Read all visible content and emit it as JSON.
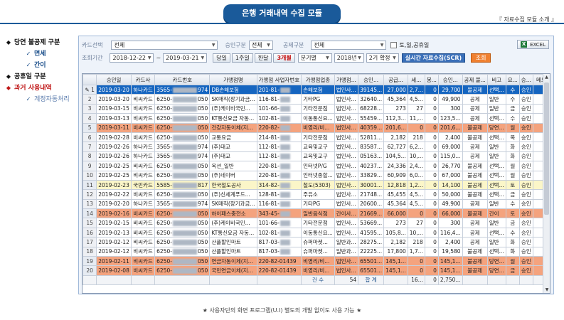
{
  "header": {
    "title": "은행 거래내역 수집 모듈",
    "caption": "『 자료수집 모듈 소개 』"
  },
  "nav": [
    {
      "label": "당연 불공제 구분",
      "level": 1
    },
    {
      "label": "면세",
      "level": 2
    },
    {
      "label": "간이",
      "level": 2
    },
    {
      "label": "공휴일 구분",
      "level": 1
    },
    {
      "label": "과거 사용내역",
      "level": 1,
      "active": true
    },
    {
      "label": "계정자동처리",
      "level": 2,
      "sub": true
    }
  ],
  "filters": {
    "card_label": "카드선택",
    "card_value": "전체",
    "approval_label": "승인구분",
    "approval_value": "전체",
    "deduct_label": "공제구분",
    "deduct_value": "전체",
    "holiday_label": "토,일,공휴일",
    "excel_label": "EXCEL",
    "period_label": "조회기간",
    "date_from": "2018-12-22",
    "tilde": "~",
    "date_to": "2019-03-21",
    "btn_day": "당일",
    "btn_week": "1주일",
    "btn_half_month": "한달",
    "btn_3month": "3개월",
    "quarter_value": "분기별",
    "year_value": "2018년",
    "term_value": "2기 확정",
    "realtime_btn": "실시간 자료수집(SCR)",
    "search_btn": "조회"
  },
  "columns": [
    "",
    "승인일",
    "카드사",
    "카드번호",
    "가맹점명",
    "가맹점 사업자번호",
    "가맹점업종",
    "가맹점...",
    "승인...",
    "공급...",
    "세...",
    "봉...",
    "승인...",
    "공제 불...",
    "비고",
    "요...",
    "승...",
    "메모"
  ],
  "rows": [
    {
      "n": "1",
      "d": "2019-03-20",
      "co": "하나카드",
      "p1": "3565-",
      "p2": "974",
      "m": "DB손해보험",
      "b1": "201-81-",
      "b2": "",
      "t": "손해보험",
      "ty": "법인사...",
      "a": "39145...",
      "s": "27,000",
      "v": "2,7...",
      "f": "0",
      "tot": "29,700",
      "ded": "불공제",
      "note": "선택...",
      "dy": "수",
      "st": "승인",
      "style": "sel"
    },
    {
      "n": "2",
      "d": "2019-03-20",
      "co": "비씨카드",
      "p1": "6250-",
      "p2": "050",
      "m": "SK매직(장기과금...",
      "b1": "116-81-",
      "b2": "",
      "t": "기타PG",
      "ty": "법인사...",
      "a": "32640...",
      "s": "45,364",
      "v": "4,5...",
      "f": "0",
      "tot": "49,900",
      "ded": "공제",
      "note": "일반",
      "dy": "수",
      "st": "승인",
      "style": ""
    },
    {
      "n": "3",
      "d": "2019-03-15",
      "co": "비씨카드",
      "p1": "6250-",
      "p2": "050",
      "m": "(주)케이비국민...",
      "b1": "101-66-",
      "b2": "",
      "t": "기타전문점",
      "ty": "법인사...",
      "a": "68228...",
      "s": "273",
      "v": "27",
      "f": "0",
      "tot": "300",
      "ded": "공제",
      "note": "일반",
      "dy": "금",
      "st": "승인",
      "style": ""
    },
    {
      "n": "4",
      "d": "2019-03-13",
      "co": "비씨카드",
      "p1": "6250-",
      "p2": "050",
      "m": "KT통신요금 자동...",
      "b1": "102-81-",
      "b2": "",
      "t": "이동통신요...",
      "ty": "법인사...",
      "a": "55459...",
      "s": "112,3...",
      "v": "11,...",
      "f": "0",
      "tot": "123,5...",
      "ded": "공제",
      "note": "선택...",
      "dy": "수",
      "st": "승인",
      "style": ""
    },
    {
      "n": "5",
      "d": "2019-03-11",
      "co": "비씨카드",
      "p1": "6250-",
      "p2": "050",
      "m": "건강자동이체(지...",
      "b1": "220-82-",
      "b2": "",
      "t": "비영리/비...",
      "ty": "법인사...",
      "a": "40359...",
      "s": "201,6...",
      "v": "0",
      "f": "0",
      "tot": "201,6...",
      "ded": "불공제",
      "note": "당연...",
      "dy": "월",
      "st": "승인",
      "style": "orange"
    },
    {
      "n": "6",
      "d": "2019-02-28",
      "co": "비씨카드",
      "p1": "6250-",
      "p2": "050",
      "m": "교통요금",
      "b1": "214-81-",
      "b2": "",
      "t": "기타전문점",
      "ty": "법인사...",
      "a": "52811...",
      "s": "2,182",
      "v": "218",
      "f": "0",
      "tot": "2,400",
      "ded": "불공제",
      "note": "선택...",
      "dy": "목",
      "st": "승인",
      "style": ""
    },
    {
      "n": "7",
      "d": "2019-02-26",
      "co": "하나카드",
      "p1": "3565-",
      "p2": "974",
      "m": "(주)대교",
      "b1": "112-81-",
      "b2": "",
      "t": "교육및교구",
      "ty": "법인사...",
      "a": "83587...",
      "s": "62,727",
      "v": "6,2...",
      "f": "0",
      "tot": "69,000",
      "ded": "공제",
      "note": "일반",
      "dy": "화",
      "st": "승인",
      "style": ""
    },
    {
      "n": "8",
      "d": "2019-02-26",
      "co": "하나카드",
      "p1": "3565-",
      "p2": "974",
      "m": "(주)대교",
      "b1": "112-81-",
      "b2": "",
      "t": "교육및교구",
      "ty": "법인사...",
      "a": "05163...",
      "s": "104,5...",
      "v": "10,...",
      "f": "0",
      "tot": "115,0...",
      "ded": "공제",
      "note": "일반",
      "dy": "화",
      "st": "승인",
      "style": ""
    },
    {
      "n": "9",
      "d": "2019-02-25",
      "co": "비씨카드",
      "p1": "6250-",
      "p2": "050",
      "m": "옥션_일반",
      "b1": "220-81-",
      "b2": "",
      "t": "인터넷P/G",
      "ty": "법인사...",
      "a": "40237...",
      "s": "24,336",
      "v": "2,4...",
      "f": "0",
      "tot": "26,770",
      "ded": "불공제",
      "note": "선택...",
      "dy": "월",
      "st": "승인",
      "style": ""
    },
    {
      "n": "10",
      "d": "2019-02-25",
      "co": "비씨카드",
      "p1": "6250-",
      "p2": "050",
      "m": "(주)네이버",
      "b1": "220-81-",
      "b2": "",
      "t": "인터넷종합...",
      "ty": "법인사...",
      "a": "33829...",
      "s": "60,909",
      "v": "6,0...",
      "f": "0",
      "tot": "67,000",
      "ded": "불공제",
      "note": "선택...",
      "dy": "월",
      "st": "승인",
      "style": ""
    },
    {
      "n": "11",
      "d": "2019-02-23",
      "co": "국민카드",
      "p1": "5585-",
      "p2": "817",
      "m": "한국철도공사",
      "b1": "314-82-",
      "b2": "",
      "t": "철도(5303)",
      "ty": "법인사...",
      "a": "30001...",
      "s": "12,818",
      "v": "1,2...",
      "f": "0",
      "tot": "14,100",
      "ded": "불공제",
      "note": "선택...",
      "dy": "토",
      "st": "승인",
      "style": "yellow"
    },
    {
      "n": "12",
      "d": "2019-02-22",
      "co": "비씨카드",
      "p1": "6250-",
      "p2": "050",
      "m": "(주)신세계푸드...",
      "b1": "128-81-",
      "b2": "",
      "t": "주유소",
      "ty": "법인사...",
      "a": "21748...",
      "s": "45,455",
      "v": "4,5...",
      "f": "0",
      "tot": "50,000",
      "ded": "불공제",
      "note": "선택...",
      "dy": "금",
      "st": "승인",
      "style": ""
    },
    {
      "n": "13",
      "d": "2019-02-20",
      "co": "하나카드",
      "p1": "3565-",
      "p2": "974",
      "m": "SK매직(장기과금...",
      "b1": "116-81-",
      "b2": "",
      "t": "기타PG",
      "ty": "법인사...",
      "a": "20600...",
      "s": "45,364",
      "v": "4,5...",
      "f": "0",
      "tot": "49,900",
      "ded": "공제",
      "note": "일반",
      "dy": "수",
      "st": "승인",
      "style": ""
    },
    {
      "n": "14",
      "d": "2019-02-16",
      "co": "비씨카드",
      "p1": "6250-",
      "p2": "050",
      "m": "하이패스충전소",
      "b1": "343-45-",
      "b2": "",
      "t": "일반음식점",
      "ty": "간이사...",
      "a": "21669...",
      "s": "66,000",
      "v": "0",
      "f": "0",
      "tot": "66,000",
      "ded": "불공제",
      "note": "간이",
      "dy": "토",
      "st": "승인",
      "style": "orange"
    },
    {
      "n": "15",
      "d": "2019-02-15",
      "co": "비씨카드",
      "p1": "6250-",
      "p2": "050",
      "m": "(주)케이비국민...",
      "b1": "101-66-",
      "b2": "",
      "t": "기타전문점",
      "ty": "법인사...",
      "a": "53669...",
      "s": "273",
      "v": "27",
      "f": "0",
      "tot": "300",
      "ded": "공제",
      "note": "일반",
      "dy": "금",
      "st": "승인",
      "style": ""
    },
    {
      "n": "16",
      "d": "2019-02-13",
      "co": "비씨카드",
      "p1": "6250-",
      "p2": "050",
      "m": "KT통신요금 자동...",
      "b1": "102-81-",
      "b2": "",
      "t": "이동통신요...",
      "ty": "법인사...",
      "a": "41595...",
      "s": "105,8...",
      "v": "10,...",
      "f": "0",
      "tot": "116,4...",
      "ded": "공제",
      "note": "선택...",
      "dy": "수",
      "st": "승인",
      "style": ""
    },
    {
      "n": "17",
      "d": "2019-02-12",
      "co": "비씨카드",
      "p1": "6250-",
      "p2": "050",
      "m": "산플할인마트",
      "b1": "817-03-",
      "b2": "",
      "t": "슈퍼마켓...",
      "ty": "일반과...",
      "a": "28275...",
      "s": "2,182",
      "v": "218",
      "f": "0",
      "tot": "2,400",
      "ded": "공제",
      "note": "일반",
      "dy": "화",
      "st": "승인",
      "style": ""
    },
    {
      "n": "18",
      "d": "2019-02-12",
      "co": "비씨카드",
      "p1": "6250-",
      "p2": "050",
      "m": "산플할인마트",
      "b1": "817-03-",
      "b2": "",
      "t": "슈퍼마켓...",
      "ty": "일반과...",
      "a": "22225...",
      "s": "17,800",
      "v": "1,7...",
      "f": "0",
      "tot": "19,580",
      "ded": "불공제",
      "note": "선택...",
      "dy": "화",
      "st": "승인",
      "style": ""
    },
    {
      "n": "19",
      "d": "2019-02-11",
      "co": "비씨카드",
      "p1": "6250-",
      "p2": "050",
      "m": "연금자동이체(지...",
      "b1": "220-82-01439",
      "b2": "",
      "t": "비영리/비...",
      "ty": "법인사...",
      "a": "65501...",
      "s": "145,1...",
      "v": "0",
      "f": "0",
      "tot": "145,1...",
      "ded": "불공제",
      "note": "당연...",
      "dy": "월",
      "st": "승인",
      "style": "orange"
    },
    {
      "n": "20",
      "d": "2019-02-08",
      "co": "비씨카드",
      "p1": "6250-",
      "p2": "050",
      "m": "국민연금이체(지...",
      "b1": "220-82-01439",
      "b2": "",
      "t": "비영리/비...",
      "ty": "법인사...",
      "a": "65501...",
      "s": "145,1...",
      "v": "0",
      "f": "0",
      "tot": "145,1...",
      "ded": "불공제",
      "note": "당연...",
      "dy": "금",
      "st": "승인",
      "style": "orange"
    }
  ],
  "footer": {
    "count_label": "건  수",
    "count_value": "54",
    "sum_label": "합  계",
    "vat_sum": "16...",
    "f_sum": "0",
    "total_sum": "2,750..."
  },
  "footnote": "★ 사용자단의 화면 프로그램(U.I) 별도의 개발 없이도 사용 가능 ★"
}
